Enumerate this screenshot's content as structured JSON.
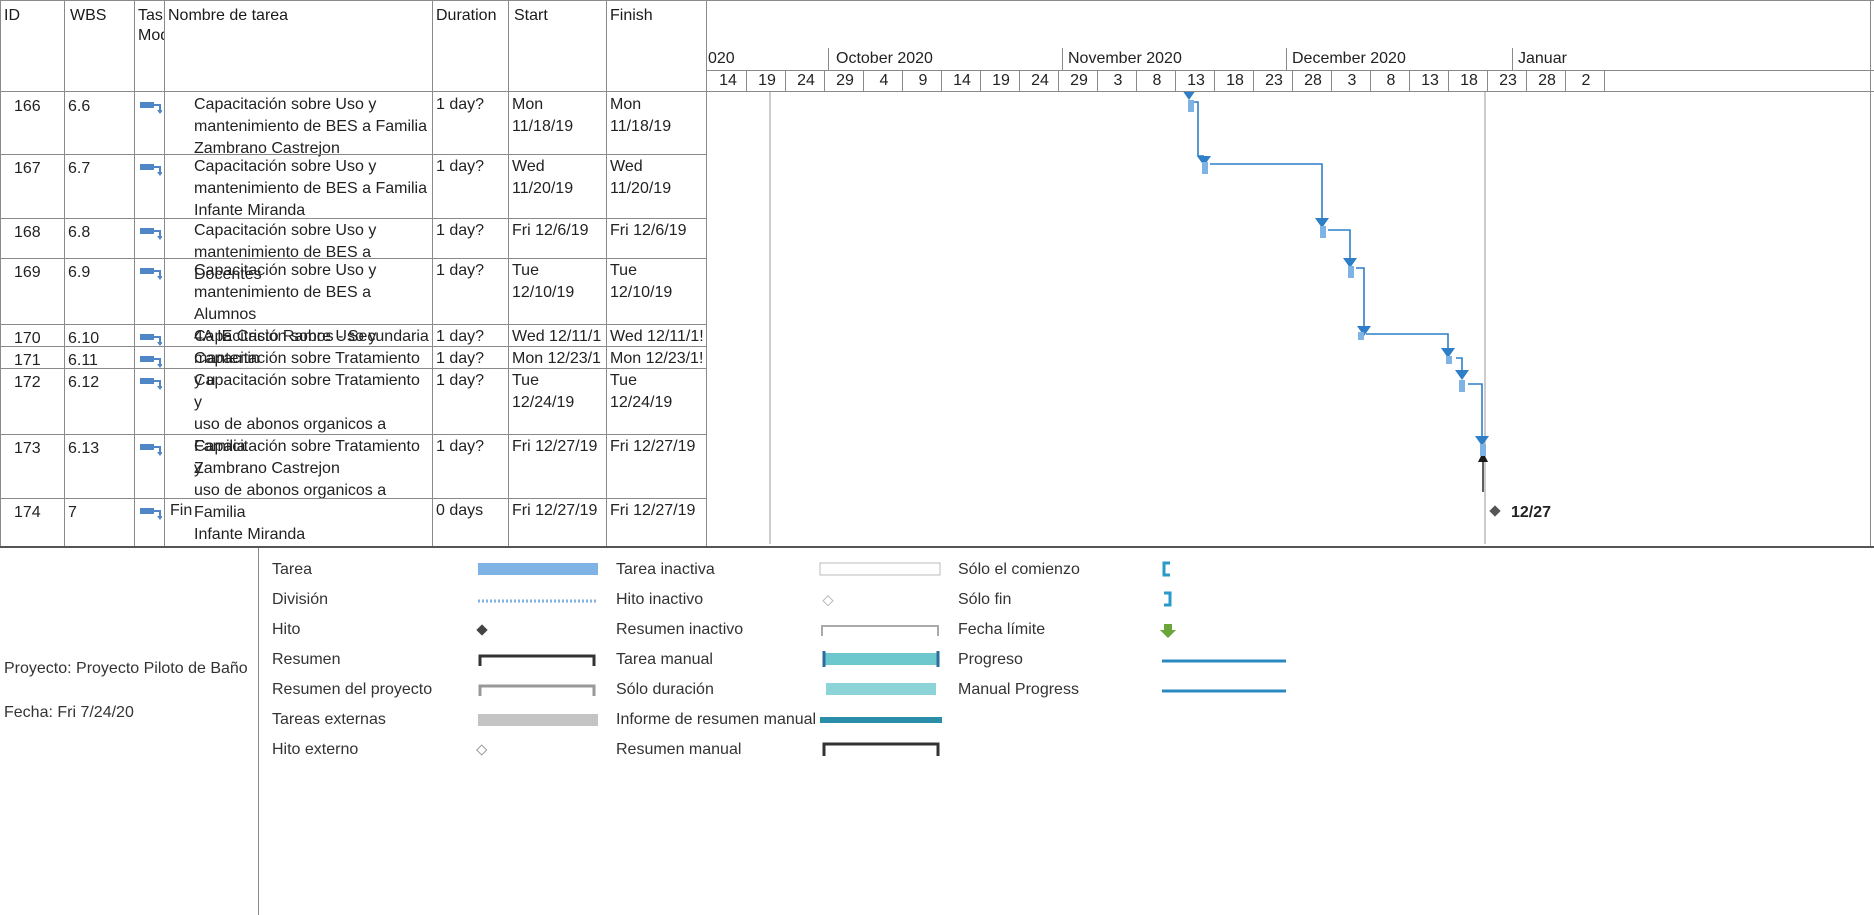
{
  "columns": {
    "id": "ID",
    "wbs": "WBS",
    "mode": "Task\nMode",
    "name": "Nombre de tarea",
    "duration": "Duration",
    "start": "Start",
    "finish": "Finish"
  },
  "timescale": {
    "months": [
      "020",
      "October 2020",
      "November 2020",
      "December 2020",
      "Januar"
    ],
    "days": [
      "14",
      "19",
      "24",
      "29",
      "4",
      "9",
      "14",
      "19",
      "24",
      "29",
      "3",
      "8",
      "13",
      "18",
      "23",
      "28",
      "3",
      "8",
      "13",
      "18",
      "23",
      "28",
      "2"
    ]
  },
  "rows": [
    {
      "id": "166",
      "wbs": "6.6",
      "name": "Capacitación sobre Uso y\nmantenimiento de BES a Familia\nZambrano Castrejon",
      "duration": "1 day?",
      "start": "Mon\n11/18/19",
      "finish": "Mon\n11/18/19"
    },
    {
      "id": "167",
      "wbs": "6.7",
      "name": "Capacitación sobre Uso y\nmantenimiento de BES a Familia\nInfante Miranda",
      "duration": "1 day?",
      "start": "Wed\n11/20/19",
      "finish": "Wed\n11/20/19"
    },
    {
      "id": "168",
      "wbs": "6.8",
      "name": "Capacitación sobre Uso y\nmantenimiento de BES a Docentes",
      "duration": "1 day?",
      "start": "Fri 12/6/19",
      "finish": "Fri 12/6/19"
    },
    {
      "id": "169",
      "wbs": "6.9",
      "name": "Capacitación sobre Uso y\nmantenimiento de BES a Alumnos\n4A IE Cristo Ramos - Secundaria",
      "duration": "1 day?",
      "start": "Tue\n12/10/19",
      "finish": "Tue\n12/10/19"
    },
    {
      "id": "170",
      "wbs": "6.10",
      "name": "Capacitación sobre Uso y mantenin",
      "duration": "1 day?",
      "start": "Wed 12/11/1",
      "finish": "Wed 12/11/1!"
    },
    {
      "id": "171",
      "wbs": "6.11",
      "name": "Capacitación sobre Tratamiento y u",
      "duration": "1 day?",
      "start": "Mon 12/23/1",
      "finish": "Mon 12/23/1!"
    },
    {
      "id": "172",
      "wbs": "6.12",
      "name": "Capacitación sobre Tratamiento y\nuso de abonos organicos a Familia\nZambrano Castrejon",
      "duration": "1 day?",
      "start": "Tue\n12/24/19",
      "finish": "Tue\n12/24/19"
    },
    {
      "id": "173",
      "wbs": "6.13",
      "name": "Capacitación sobre Tratamiento y\nuso de abonos organicos a Familia\nInfante Miranda",
      "duration": "1 day?",
      "start": "Fri 12/27/19",
      "finish": "Fri 12/27/19"
    },
    {
      "id": "174",
      "wbs": "7",
      "name": "Fin",
      "duration": "0 days",
      "start": "Fri 12/27/19",
      "finish": "Fri 12/27/19"
    }
  ],
  "milestone_label": "12/27",
  "project_info": {
    "project": "Proyecto: Proyecto Piloto de Baño",
    "date": "Fecha: Fri 7/24/20"
  },
  "legend": {
    "col1": [
      "Tarea",
      "División",
      "Hito",
      "Resumen",
      "Resumen del proyecto",
      "Tareas externas",
      "Hito externo"
    ],
    "col2": [
      "Tarea inactiva",
      "Hito inactivo",
      "Resumen inactivo",
      "Tarea manual",
      "Sólo duración",
      "Informe de resumen manual",
      "Resumen manual"
    ],
    "col3": [
      "Sólo el comienzo",
      "Sólo fin",
      "Fecha límite",
      "Progreso",
      "Manual Progress"
    ]
  },
  "colors": {
    "task_bar": "#7fb2e5",
    "link": "#2f7fc8",
    "manual": "#6cc8cc",
    "progress": "#2a8ac0",
    "deadline": "#6aa53a",
    "grid": "#8a8a8a"
  }
}
